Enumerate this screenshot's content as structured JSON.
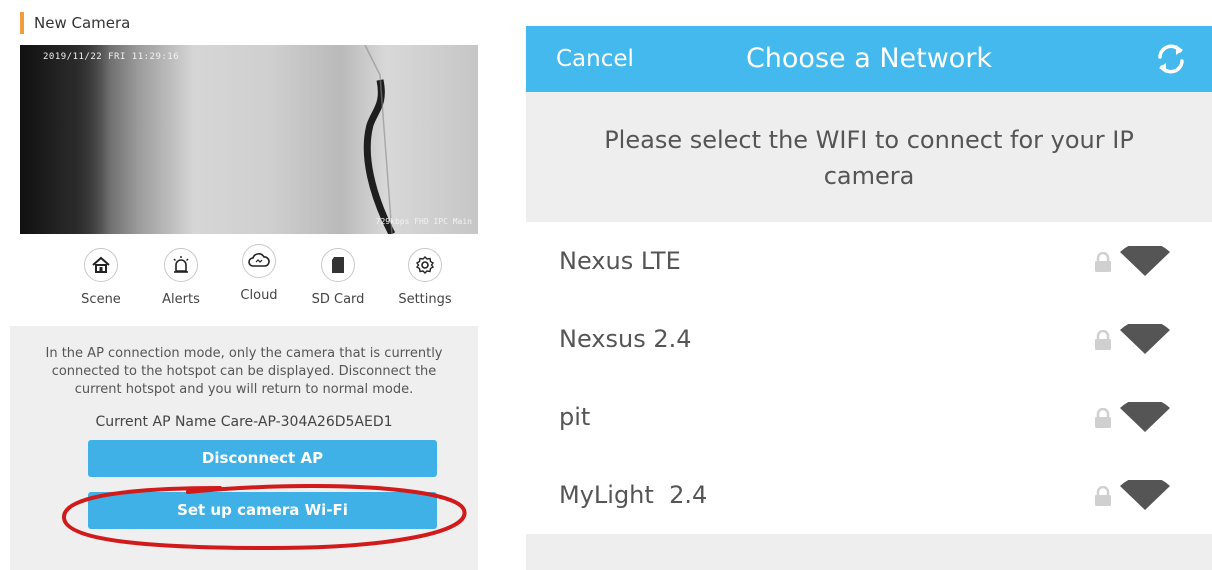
{
  "left_panel": {
    "title": "New Camera",
    "video": {
      "timestamp": "2019/11/22  FRI 11:29:16",
      "stats": "729kbps FHD IPC Main"
    },
    "actions": [
      {
        "label": "Scene",
        "icon": "home-icon"
      },
      {
        "label": "Alerts",
        "icon": "alarm-icon"
      },
      {
        "label": "Cloud",
        "icon": "cloud-icon"
      },
      {
        "label": "SD Card",
        "icon": "sd-card-icon"
      },
      {
        "label": "Settings",
        "icon": "gear-icon"
      }
    ],
    "ap_message": "In the AP connection mode, only the camera that is currently connected to the hotspot can be displayed. Disconnect the current hotspot and you will return to normal mode.",
    "ap_name": "Current AP Name Care-AP-304A26D5AED1",
    "disconnect_label": "Disconnect AP",
    "setup_label": "Set up camera Wi-Fi"
  },
  "right_panel": {
    "cancel_label": "Cancel",
    "title": "Choose a Network",
    "instruction": "Please select the WIFI to connect for your IP camera",
    "networks": [
      {
        "name": "Nexus LTE",
        "secured": true
      },
      {
        "name": "Nexsus 2.4",
        "secured": true
      },
      {
        "name": "pit",
        "secured": true
      },
      {
        "name": "MyLight  2.4",
        "secured": true
      }
    ]
  },
  "colors": {
    "header_blue": "#43b9ee",
    "button_blue": "#3fb1e7",
    "accent_orange": "#f39c3c",
    "annotation_red": "#d11a1a"
  }
}
